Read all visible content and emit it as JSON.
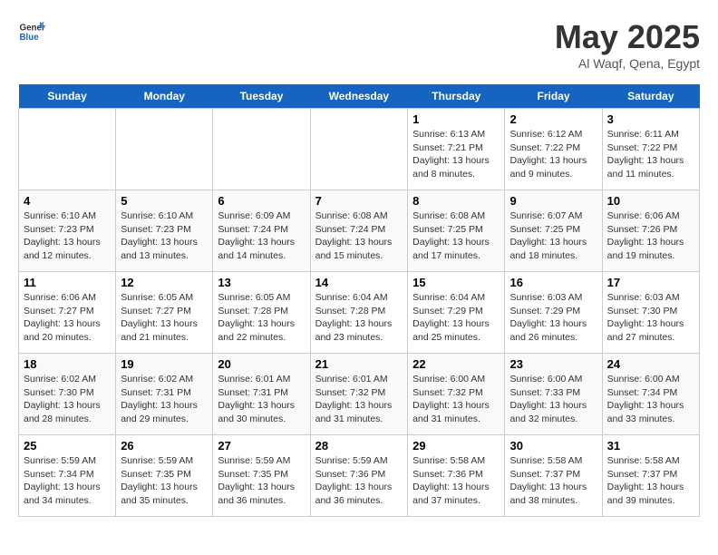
{
  "header": {
    "logo_general": "General",
    "logo_blue": "Blue",
    "title": "May 2025",
    "subtitle": "Al Waqf, Qena, Egypt"
  },
  "days_of_week": [
    "Sunday",
    "Monday",
    "Tuesday",
    "Wednesday",
    "Thursday",
    "Friday",
    "Saturday"
  ],
  "weeks": [
    [
      {
        "day": "",
        "content": ""
      },
      {
        "day": "",
        "content": ""
      },
      {
        "day": "",
        "content": ""
      },
      {
        "day": "",
        "content": ""
      },
      {
        "day": "1",
        "content": "Sunrise: 6:13 AM\nSunset: 7:21 PM\nDaylight: 13 hours and 8 minutes."
      },
      {
        "day": "2",
        "content": "Sunrise: 6:12 AM\nSunset: 7:22 PM\nDaylight: 13 hours and 9 minutes."
      },
      {
        "day": "3",
        "content": "Sunrise: 6:11 AM\nSunset: 7:22 PM\nDaylight: 13 hours and 11 minutes."
      }
    ],
    [
      {
        "day": "4",
        "content": "Sunrise: 6:10 AM\nSunset: 7:23 PM\nDaylight: 13 hours and 12 minutes."
      },
      {
        "day": "5",
        "content": "Sunrise: 6:10 AM\nSunset: 7:23 PM\nDaylight: 13 hours and 13 minutes."
      },
      {
        "day": "6",
        "content": "Sunrise: 6:09 AM\nSunset: 7:24 PM\nDaylight: 13 hours and 14 minutes."
      },
      {
        "day": "7",
        "content": "Sunrise: 6:08 AM\nSunset: 7:24 PM\nDaylight: 13 hours and 15 minutes."
      },
      {
        "day": "8",
        "content": "Sunrise: 6:08 AM\nSunset: 7:25 PM\nDaylight: 13 hours and 17 minutes."
      },
      {
        "day": "9",
        "content": "Sunrise: 6:07 AM\nSunset: 7:25 PM\nDaylight: 13 hours and 18 minutes."
      },
      {
        "day": "10",
        "content": "Sunrise: 6:06 AM\nSunset: 7:26 PM\nDaylight: 13 hours and 19 minutes."
      }
    ],
    [
      {
        "day": "11",
        "content": "Sunrise: 6:06 AM\nSunset: 7:27 PM\nDaylight: 13 hours and 20 minutes."
      },
      {
        "day": "12",
        "content": "Sunrise: 6:05 AM\nSunset: 7:27 PM\nDaylight: 13 hours and 21 minutes."
      },
      {
        "day": "13",
        "content": "Sunrise: 6:05 AM\nSunset: 7:28 PM\nDaylight: 13 hours and 22 minutes."
      },
      {
        "day": "14",
        "content": "Sunrise: 6:04 AM\nSunset: 7:28 PM\nDaylight: 13 hours and 23 minutes."
      },
      {
        "day": "15",
        "content": "Sunrise: 6:04 AM\nSunset: 7:29 PM\nDaylight: 13 hours and 25 minutes."
      },
      {
        "day": "16",
        "content": "Sunrise: 6:03 AM\nSunset: 7:29 PM\nDaylight: 13 hours and 26 minutes."
      },
      {
        "day": "17",
        "content": "Sunrise: 6:03 AM\nSunset: 7:30 PM\nDaylight: 13 hours and 27 minutes."
      }
    ],
    [
      {
        "day": "18",
        "content": "Sunrise: 6:02 AM\nSunset: 7:30 PM\nDaylight: 13 hours and 28 minutes."
      },
      {
        "day": "19",
        "content": "Sunrise: 6:02 AM\nSunset: 7:31 PM\nDaylight: 13 hours and 29 minutes."
      },
      {
        "day": "20",
        "content": "Sunrise: 6:01 AM\nSunset: 7:31 PM\nDaylight: 13 hours and 30 minutes."
      },
      {
        "day": "21",
        "content": "Sunrise: 6:01 AM\nSunset: 7:32 PM\nDaylight: 13 hours and 31 minutes."
      },
      {
        "day": "22",
        "content": "Sunrise: 6:00 AM\nSunset: 7:32 PM\nDaylight: 13 hours and 31 minutes."
      },
      {
        "day": "23",
        "content": "Sunrise: 6:00 AM\nSunset: 7:33 PM\nDaylight: 13 hours and 32 minutes."
      },
      {
        "day": "24",
        "content": "Sunrise: 6:00 AM\nSunset: 7:34 PM\nDaylight: 13 hours and 33 minutes."
      }
    ],
    [
      {
        "day": "25",
        "content": "Sunrise: 5:59 AM\nSunset: 7:34 PM\nDaylight: 13 hours and 34 minutes."
      },
      {
        "day": "26",
        "content": "Sunrise: 5:59 AM\nSunset: 7:35 PM\nDaylight: 13 hours and 35 minutes."
      },
      {
        "day": "27",
        "content": "Sunrise: 5:59 AM\nSunset: 7:35 PM\nDaylight: 13 hours and 36 minutes."
      },
      {
        "day": "28",
        "content": "Sunrise: 5:59 AM\nSunset: 7:36 PM\nDaylight: 13 hours and 36 minutes."
      },
      {
        "day": "29",
        "content": "Sunrise: 5:58 AM\nSunset: 7:36 PM\nDaylight: 13 hours and 37 minutes."
      },
      {
        "day": "30",
        "content": "Sunrise: 5:58 AM\nSunset: 7:37 PM\nDaylight: 13 hours and 38 minutes."
      },
      {
        "day": "31",
        "content": "Sunrise: 5:58 AM\nSunset: 7:37 PM\nDaylight: 13 hours and 39 minutes."
      }
    ]
  ]
}
